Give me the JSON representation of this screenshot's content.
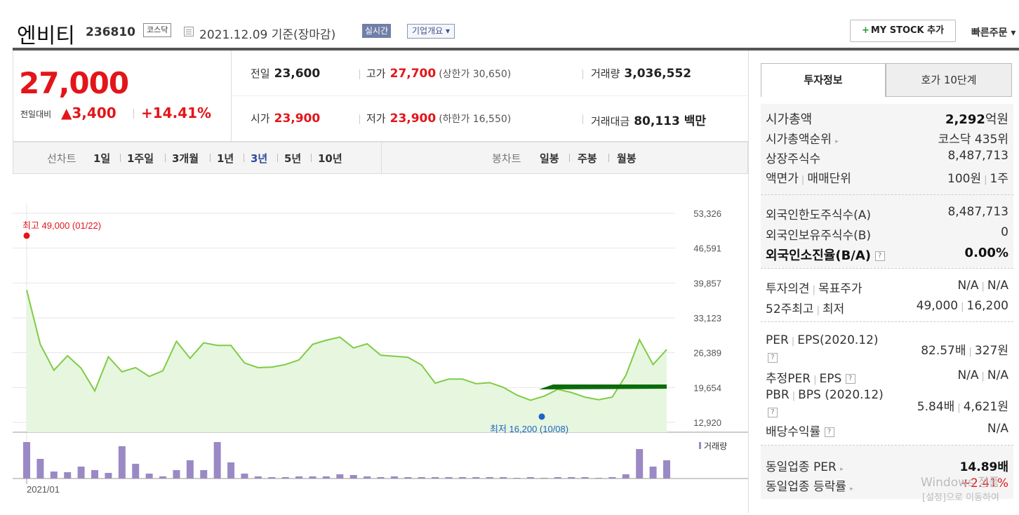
{
  "header": {
    "name": "엔비티",
    "code": "236810",
    "market": "코스닥",
    "date": "2021.12.09 기준(장마감)",
    "realtime": "실시간",
    "company_btn": "기업개요 ▾",
    "mystock_plus": "+",
    "mystock_label": "MY STOCK 추가",
    "quickorder": "빠른주문 ▾"
  },
  "price": {
    "current": "27,000",
    "change_label": "전일대비",
    "change_arrow": "▲",
    "change_value": "3,400",
    "change_pct": "+14.41%"
  },
  "info": {
    "prev_label": "전일",
    "prev": "23,600",
    "high_label": "고가",
    "high": "27,700",
    "high_limit": "(상한가 30,650)",
    "volume_label": "거래량",
    "volume": "3,036,552",
    "open_label": "시가",
    "open": "23,900",
    "low_label": "저가",
    "low": "23,900",
    "low_limit": "(하한가 16,550)",
    "amount_label": "거래대금",
    "amount": "80,113 백만"
  },
  "tabs": {
    "line_label": "선차트",
    "line_items": [
      "1일",
      "1주일",
      "3개월",
      "1년",
      "3년",
      "5년",
      "10년"
    ],
    "candle_label": "봉차트",
    "candle_items": [
      "일봉",
      "주봉",
      "월봉"
    ]
  },
  "chart_data": {
    "type": "area",
    "y_ticks": [
      "53,326",
      "46,591",
      "39,857",
      "33,123",
      "26,389",
      "19,654",
      "12,920"
    ],
    "y_tick_values": [
      53326,
      46591,
      39857,
      33123,
      26389,
      19654,
      12920
    ],
    "ylim": [
      12920,
      53326
    ],
    "x_labels": [
      "2021/01"
    ],
    "series": [
      {
        "values": [
          38500,
          28000,
          23000,
          25800,
          23400,
          19000,
          25600,
          22700,
          23500,
          21800,
          22900,
          28600,
          25300,
          28300,
          27800,
          27800,
          24400,
          23500,
          23600,
          24100,
          25000,
          28000,
          28800,
          29400,
          27300,
          28100,
          25900,
          25700,
          25500,
          24000,
          20500,
          21300,
          21300,
          20400,
          20600,
          19700,
          18200,
          17200,
          18000,
          19300,
          18700,
          17800,
          17300,
          17800,
          22000,
          28900,
          24100,
          27000
        ]
      }
    ],
    "max_label": "최고 49,000 (01/22)",
    "min_label": "최저 16,200 (10/08)",
    "max_value": 49000,
    "min_value": 16200,
    "volume_label": "거래량",
    "volumes": [
      52,
      28,
      10,
      9,
      17,
      12,
      8,
      46,
      21,
      7,
      3,
      12,
      26,
      12,
      52,
      23,
      7,
      3,
      2,
      2,
      3,
      3,
      3,
      6,
      5,
      3,
      2,
      3,
      2,
      2,
      2,
      2,
      2,
      2,
      2,
      2,
      1,
      2,
      1,
      2,
      2,
      2,
      1,
      2,
      6,
      42,
      17,
      26
    ],
    "colors": {
      "line": "#7fcc44",
      "fill": "#e6f6df",
      "max": "#e3151a",
      "min": "#1f63c6",
      "volume": "#9b89c6",
      "ma": "#0b6b0b"
    }
  },
  "right": {
    "tab1": "투자정보",
    "tab2": "호가 10단계",
    "rows1": [
      {
        "label": "시가총액",
        "value_b": "2,292",
        "value": "억원"
      },
      {
        "label": "시가총액순위",
        "value": "코스닥 435위"
      },
      {
        "label": "상장주식수",
        "value": "8,487,713"
      },
      {
        "label": "액면가",
        "label2": "매매단위",
        "value": "100원",
        "value2": "1주"
      }
    ],
    "rows2": [
      {
        "label": "외국인한도주식수(A)",
        "value": "8,487,713"
      },
      {
        "label": "외국인보유주식수(B)",
        "value": "0"
      },
      {
        "label": "외국인소진율(B/A)",
        "value": "0.00%"
      }
    ],
    "rows3": [
      {
        "label": "투자의견",
        "label2": "목표주가",
        "value": "N/A",
        "value2": "N/A"
      },
      {
        "label": "52주최고",
        "label2": "최저",
        "value": "49,000",
        "value2": "16,200"
      }
    ],
    "rows4": [
      {
        "label": "PER",
        "label2": "EPS(2020.12)",
        "value": "82.57배",
        "value2": "327원"
      },
      {
        "label": "추정PER",
        "label2": "EPS",
        "value": "N/A",
        "value2": "N/A"
      },
      {
        "label": "PBR",
        "label2": "BPS (2020.12)",
        "value": "5.84배",
        "value2": "4,621원"
      },
      {
        "label": "배당수익률",
        "value": "N/A"
      }
    ],
    "rows5": [
      {
        "label": "동일업종 PER",
        "value": "14.89배"
      },
      {
        "label": "동일업종 등락률",
        "value": "+2.41%"
      }
    ],
    "help": "?"
  },
  "watermark": {
    "line1": "Windows 정품",
    "line2": "[설정]으로 이동하여"
  }
}
